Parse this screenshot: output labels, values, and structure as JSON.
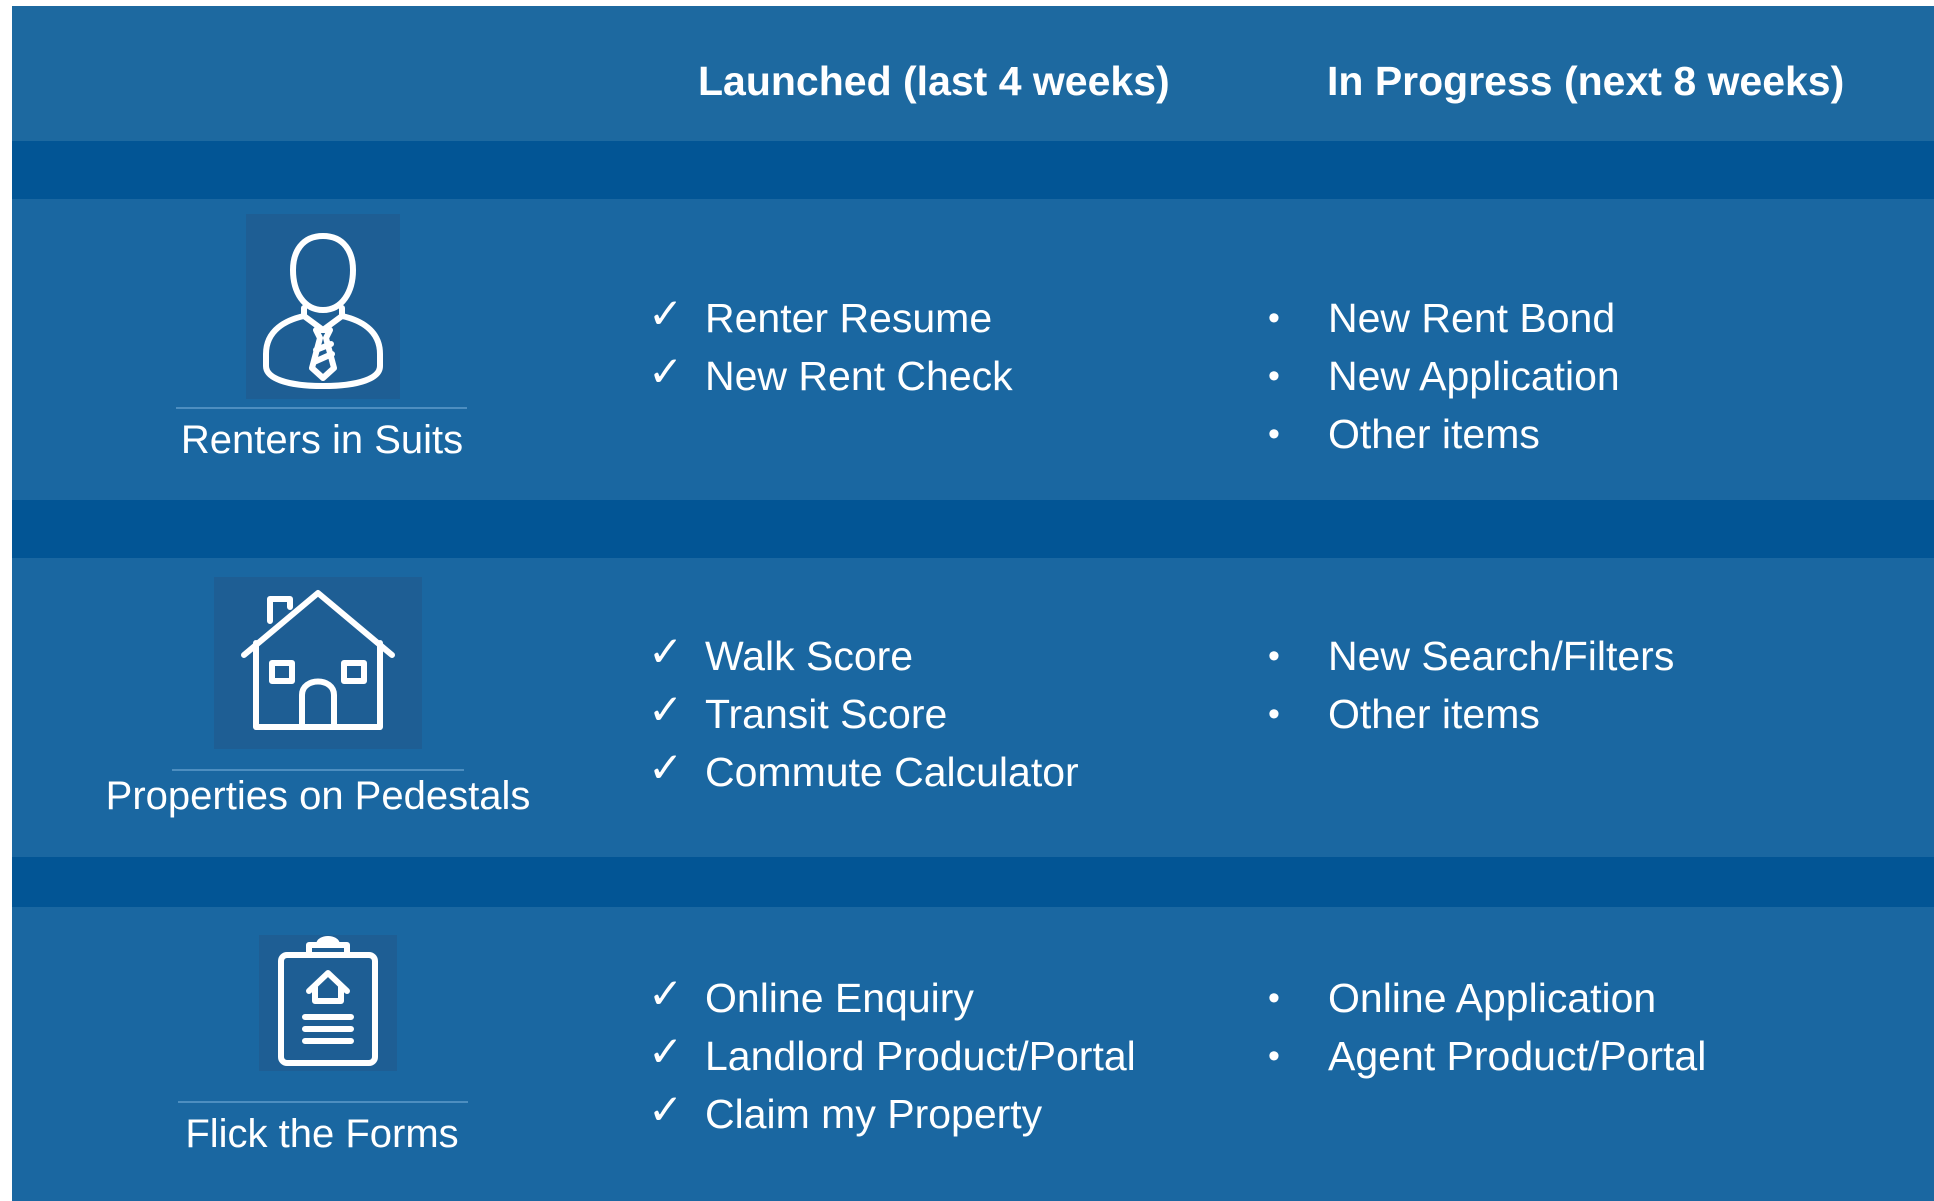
{
  "header": {
    "launched_title": "Launched (last 4 weeks)",
    "progress_title": "In Progress (next 8 weeks)"
  },
  "colors": {
    "header_bg": "#1d69a0",
    "band_bg": "#025595",
    "row_bg": "#1a67a1",
    "icon_bg": "#1e5e94",
    "text": "#ffffff"
  },
  "rows": [
    {
      "icon": "person-in-suit-icon",
      "label": "Renters in Suits",
      "launched": [
        "Renter Resume",
        "New Rent Check"
      ],
      "in_progress": [
        "New Rent Bond",
        "New Application",
        "Other items"
      ]
    },
    {
      "icon": "house-icon",
      "label": "Properties on Pedestals",
      "launched": [
        "Walk Score",
        "Transit Score",
        "Commute Calculator"
      ],
      "in_progress": [
        "New Search/Filters",
        "Other items"
      ]
    },
    {
      "icon": "clipboard-house-icon",
      "label": "Flick the Forms",
      "launched": [
        "Online Enquiry",
        "Landlord Product/Portal",
        "Claim my Property"
      ],
      "in_progress": [
        "Online Application",
        "Agent Product/Portal"
      ]
    }
  ],
  "marks": {
    "check": "✓",
    "bullet": "•"
  }
}
